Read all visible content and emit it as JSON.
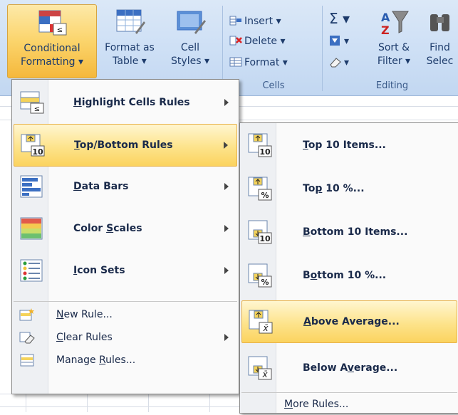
{
  "ribbon": {
    "styles_group": {
      "conditional_formatting": [
        "Conditional",
        "Formatting ▾"
      ],
      "format_as_table": [
        "Format as",
        "Table ▾"
      ],
      "cell_styles": [
        "Cell",
        "Styles ▾"
      ]
    },
    "cells_group": {
      "insert": "Insert ▾",
      "delete": "Delete ▾",
      "format": "Format ▾",
      "label": "Cells"
    },
    "editing_group": {
      "sum_symbol": "Σ ▾",
      "fill_symbol": "▾",
      "clear_symbol": "▾",
      "sort_filter": [
        "Sort &",
        "Filter ▾"
      ],
      "find_select": [
        "Find",
        "Selec"
      ],
      "label": "Editing"
    }
  },
  "menu": {
    "items": [
      {
        "label": "Highlight Cells Rules",
        "accel": "H",
        "before": "",
        "after": "ighlight Cells Rules"
      },
      {
        "label": "Top/Bottom Rules",
        "accel": "T",
        "before": "",
        "after": "op/Bottom Rules"
      },
      {
        "label": "Data Bars",
        "accel": "D",
        "before": "",
        "after": "ata Bars"
      },
      {
        "label": "Color Scales",
        "accel": "S",
        "before": "Color ",
        "after": "cales"
      },
      {
        "label": "Icon Sets",
        "accel": "I",
        "before": "",
        "after": "con Sets"
      }
    ],
    "footer": [
      {
        "label": "New Rule...",
        "before": "",
        "accel": "N",
        "after": "ew Rule..."
      },
      {
        "label": "Clear Rules",
        "before": "",
        "accel": "C",
        "after": "lear Rules"
      },
      {
        "label": "Manage Rules...",
        "before": "Manage ",
        "accel": "R",
        "after": "ules..."
      }
    ]
  },
  "submenu": {
    "items": [
      {
        "label": "Top 10 Items...",
        "before": "",
        "accel": "T",
        "after": "op 10 Items...",
        "icon": "top10",
        "badge": "10"
      },
      {
        "label": "Top 10 %...",
        "before": "To",
        "accel": "p",
        "after": " 10 %...",
        "icon": "top10pct",
        "badge": "%"
      },
      {
        "label": "Bottom 10 Items...",
        "before": "",
        "accel": "B",
        "after": "ottom 10 Items...",
        "icon": "bottom10",
        "badge": "10"
      },
      {
        "label": "Bottom 10 %...",
        "before": "B",
        "accel": "o",
        "after": "ttom 10 %...",
        "icon": "bottom10pct",
        "badge": "%"
      },
      {
        "label": "Above Average...",
        "before": "",
        "accel": "A",
        "after": "bove Average...",
        "icon": "above-average",
        "badge": "x̄"
      },
      {
        "label": "Below Average...",
        "before": "Below A",
        "accel": "v",
        "after": "erage...",
        "icon": "below-average",
        "badge": "x̄"
      }
    ],
    "more_rules": {
      "before": "",
      "accel": "M",
      "after": "ore Rules..."
    }
  },
  "colors": {
    "highlight": "#fbd35f",
    "ribbon": "#cddff5",
    "text": "#1a2a4a"
  }
}
